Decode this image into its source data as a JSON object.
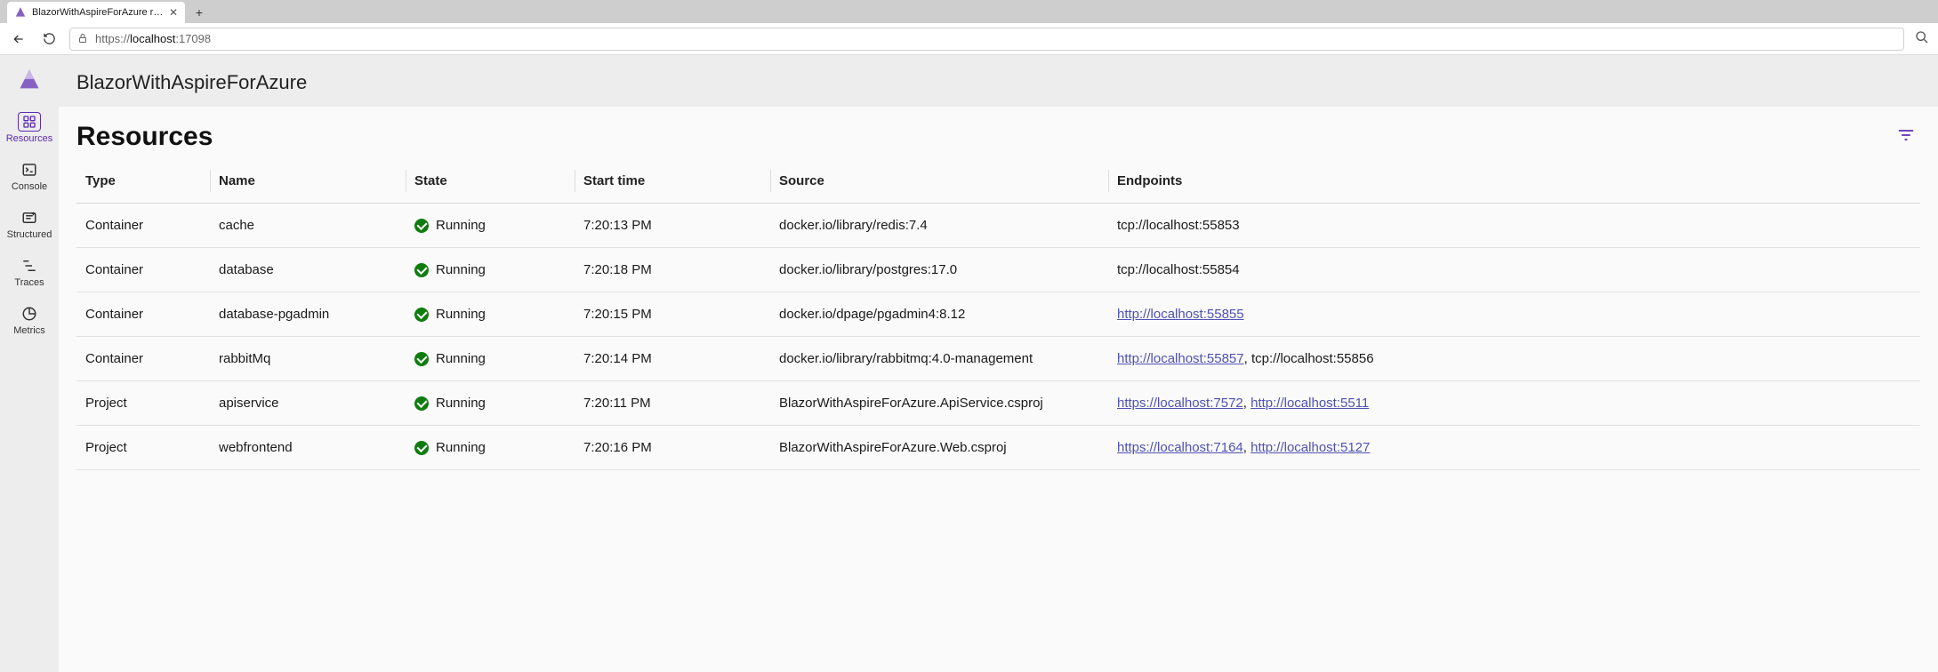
{
  "browser": {
    "tab_title": "BlazorWithAspireForAzure resour…",
    "url_prefix": "https://",
    "url_host": "localhost",
    "url_port": ":17098"
  },
  "colors": {
    "accent": "#5b2ab5",
    "running": "#107c10",
    "link": "#4f52b2"
  },
  "sidebar": {
    "items": [
      {
        "id": "resources",
        "label": "Resources",
        "active": true
      },
      {
        "id": "console",
        "label": "Console",
        "active": false
      },
      {
        "id": "structured",
        "label": "Structured",
        "active": false
      },
      {
        "id": "traces",
        "label": "Traces",
        "active": false
      },
      {
        "id": "metrics",
        "label": "Metrics",
        "active": false
      }
    ]
  },
  "header": {
    "app_title": "BlazorWithAspireForAzure"
  },
  "page": {
    "title": "Resources"
  },
  "table": {
    "columns": {
      "type": "Type",
      "name": "Name",
      "state": "State",
      "start": "Start time",
      "source": "Source",
      "endpoints": "Endpoints"
    },
    "rows": [
      {
        "type": "Container",
        "name": "cache",
        "state": "Running",
        "start": "7:20:13 PM",
        "source": "docker.io/library/redis:7.4",
        "endpoints": [
          {
            "text": "tcp://localhost:55853",
            "link": false
          }
        ]
      },
      {
        "type": "Container",
        "name": "database",
        "state": "Running",
        "start": "7:20:18 PM",
        "source": "docker.io/library/postgres:17.0",
        "endpoints": [
          {
            "text": "tcp://localhost:55854",
            "link": false
          }
        ]
      },
      {
        "type": "Container",
        "name": "database-pgadmin",
        "state": "Running",
        "start": "7:20:15 PM",
        "source": "docker.io/dpage/pgadmin4:8.12",
        "endpoints": [
          {
            "text": "http://localhost:55855",
            "link": true
          }
        ]
      },
      {
        "type": "Container",
        "name": "rabbitMq",
        "state": "Running",
        "start": "7:20:14 PM",
        "source": "docker.io/library/rabbitmq:4.0-management",
        "endpoints": [
          {
            "text": "http://localhost:55857",
            "link": true
          },
          {
            "text": "tcp://localhost:55856",
            "link": false
          }
        ]
      },
      {
        "type": "Project",
        "name": "apiservice",
        "state": "Running",
        "start": "7:20:11 PM",
        "source": "BlazorWithAspireForAzure.ApiService.csproj",
        "endpoints": [
          {
            "text": "https://localhost:7572",
            "link": true
          },
          {
            "text": "http://localhost:5511",
            "link": true
          }
        ]
      },
      {
        "type": "Project",
        "name": "webfrontend",
        "state": "Running",
        "start": "7:20:16 PM",
        "source": "BlazorWithAspireForAzure.Web.csproj",
        "endpoints": [
          {
            "text": "https://localhost:7164",
            "link": true
          },
          {
            "text": "http://localhost:5127",
            "link": true
          }
        ]
      }
    ]
  }
}
